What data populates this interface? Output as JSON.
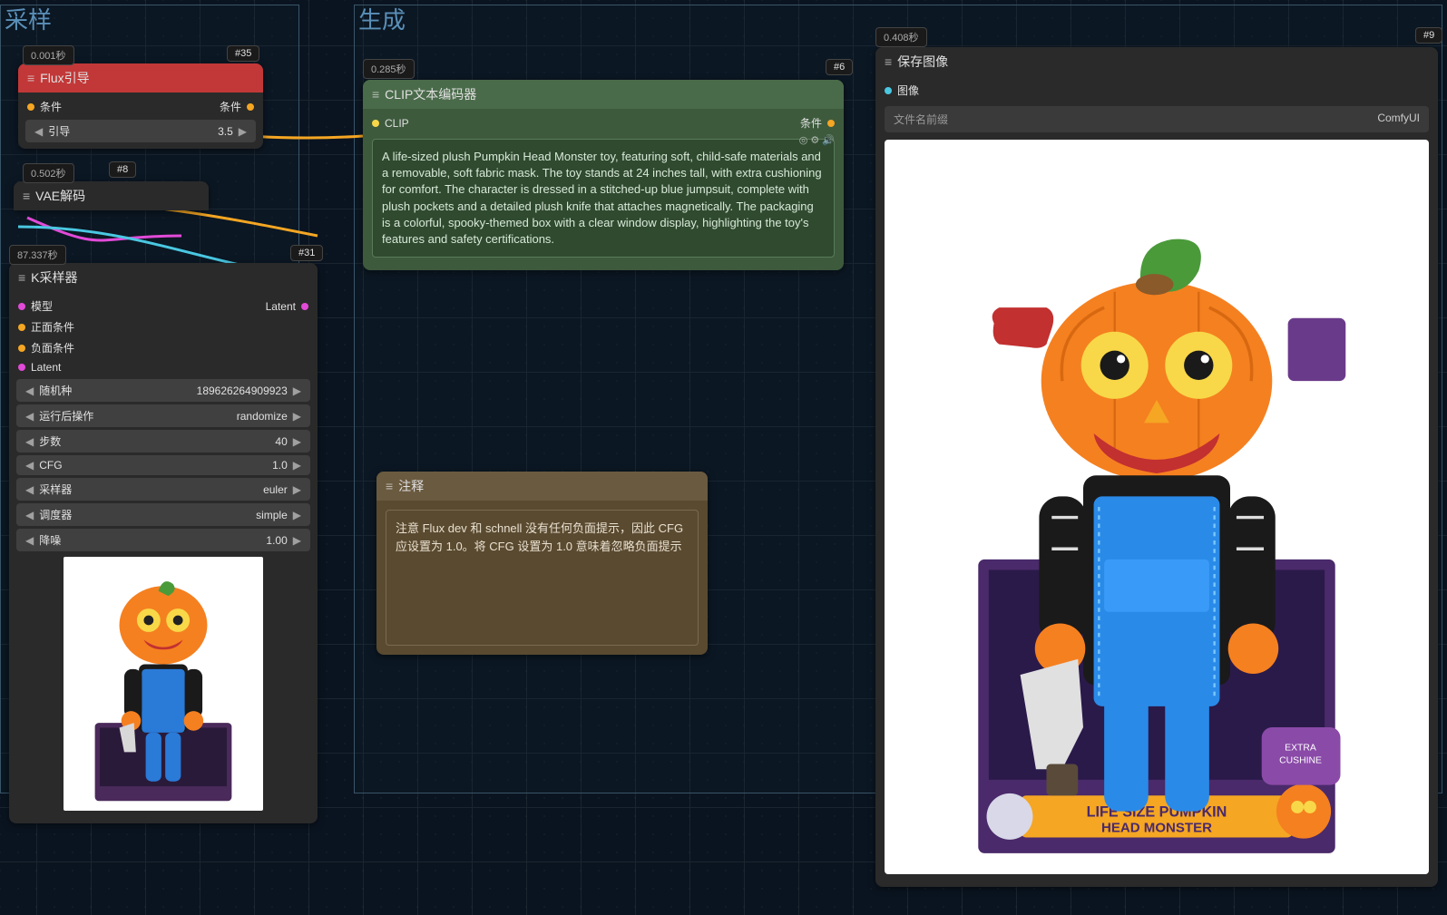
{
  "groups": {
    "sampling": {
      "label": "采样"
    },
    "generation": {
      "label": "生成"
    }
  },
  "flux_node": {
    "title": "Flux引导",
    "port_in": "条件",
    "port_out": "条件",
    "widget_label": "引导",
    "widget_value": "3.5"
  },
  "vae_node": {
    "title": "VAE解码"
  },
  "ksampler": {
    "title": "K采样器",
    "ports": {
      "model": "模型",
      "positive": "正面条件",
      "negative": "负面条件",
      "latent": "Latent",
      "latent_out": "Latent"
    },
    "widgets": [
      {
        "label": "随机种",
        "value": "189626264909923"
      },
      {
        "label": "运行后操作",
        "value": "randomize"
      },
      {
        "label": "步数",
        "value": "40"
      },
      {
        "label": "CFG",
        "value": "1.0"
      },
      {
        "label": "采样器",
        "value": "euler"
      },
      {
        "label": "调度器",
        "value": "simple"
      },
      {
        "label": "降噪",
        "value": "1.00"
      }
    ]
  },
  "clip_node": {
    "title": "CLIP文本编码器",
    "port_clip": "CLIP",
    "port_out": "条件",
    "prompt": "A life-sized plush Pumpkin Head Monster toy, featuring soft, child-safe materials and a removable, soft fabric mask. The toy stands at 24 inches tall, with extra cushioning for comfort. The character is dressed in a stitched-up blue jumpsuit, complete with plush pockets and a detailed plush knife that attaches magnetically. The packaging is a colorful, spooky-themed box with a clear window display, highlighting the toy's features and safety certifications."
  },
  "note_node": {
    "title": "注释",
    "text": "注意 Flux dev 和 schnell 没有任何负面提示，因此 CFG 应设置为 1.0。将 CFG 设置为 1.0 意味着忽略负面提示"
  },
  "save_node": {
    "title": "保存图像",
    "port_image": "图像",
    "filename_label": "文件名前缀",
    "filename_value": "ComfyUI"
  },
  "badges": {
    "flux_time": "0.001秒",
    "flux_num": "#35",
    "vae_time": "0.502秒",
    "vae_num": "#8",
    "ksampler_time": "87.337秒",
    "ksampler_num": "#31",
    "clip_time": "0.285秒",
    "clip_num": "#6",
    "save_time": "0.408秒",
    "save_num": "#9"
  },
  "colors": {
    "orange": "#f5a623",
    "yellow": "#f8d848",
    "magenta": "#e24ad8",
    "cyan": "#4ac8e2",
    "blue": "#4a8ae2"
  }
}
